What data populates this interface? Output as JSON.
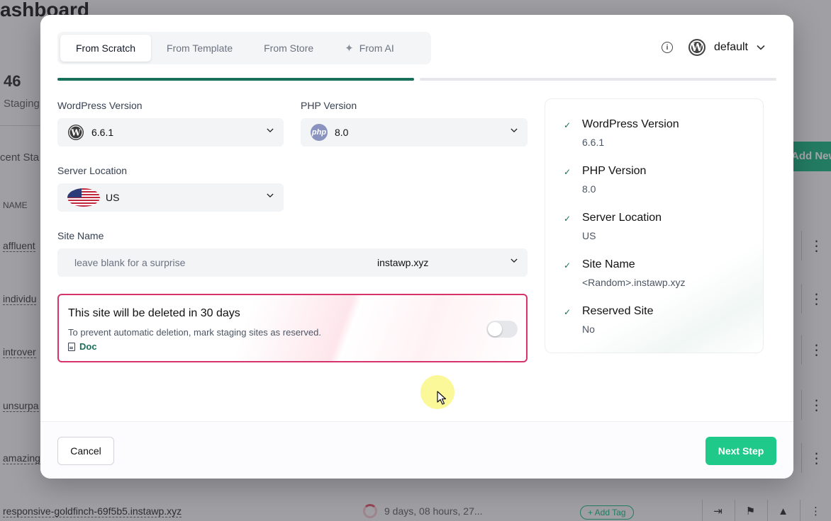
{
  "background": {
    "title_fragment": "ashboard",
    "stat_value": "46",
    "stat_label": "Staging",
    "recent_fragment": "cent Sta",
    "add_new_fragment": "Add New",
    "name_header": "NAME",
    "rows": [
      "affluent",
      "individu",
      "introver",
      "unsurpa",
      "amazing"
    ],
    "bottom_site": "responsive-goldfinch-69f5b5.instawp.xyz",
    "bottom_expiry": "9 days, 08 hours, 27...",
    "bottom_tag": "+ Add Tag"
  },
  "tabs": [
    {
      "label": "From Scratch",
      "active": true
    },
    {
      "label": "From Template",
      "active": false
    },
    {
      "label": "From Store",
      "active": false
    },
    {
      "label": "From AI",
      "active": false
    }
  ],
  "profile": {
    "label": "default",
    "icon": "wordpress-icon"
  },
  "progress": {
    "step": 1,
    "total": 2
  },
  "form": {
    "wp_version_label": "WordPress Version",
    "wp_version_value": "6.6.1",
    "php_version_label": "PHP Version",
    "php_version_value": "8.0",
    "php_badge": "php",
    "server_location_label": "Server Location",
    "server_location_value": "US",
    "site_name_label": "Site Name",
    "site_name_placeholder": "leave blank for a surprise",
    "site_name_value": "",
    "domain_value": "instawp.xyz"
  },
  "warning": {
    "title": "This site will be deleted in 30 days",
    "description": "To prevent automatic deletion, mark staging sites as reserved.",
    "doc_link": "Doc",
    "reserved_toggle": false
  },
  "summary": [
    {
      "key": "WordPress Version",
      "value": "6.6.1"
    },
    {
      "key": "PHP Version",
      "value": "8.0"
    },
    {
      "key": "Server Location",
      "value": "US"
    },
    {
      "key": "Site Name",
      "value": "<Random>.instawp.xyz"
    },
    {
      "key": "Reserved Site",
      "value": "No"
    }
  ],
  "footer": {
    "cancel_label": "Cancel",
    "next_label": "Next Step"
  },
  "colors": {
    "accent": "#17705a",
    "primary_button": "#1fc98a",
    "warning_border": "#d6336c"
  }
}
